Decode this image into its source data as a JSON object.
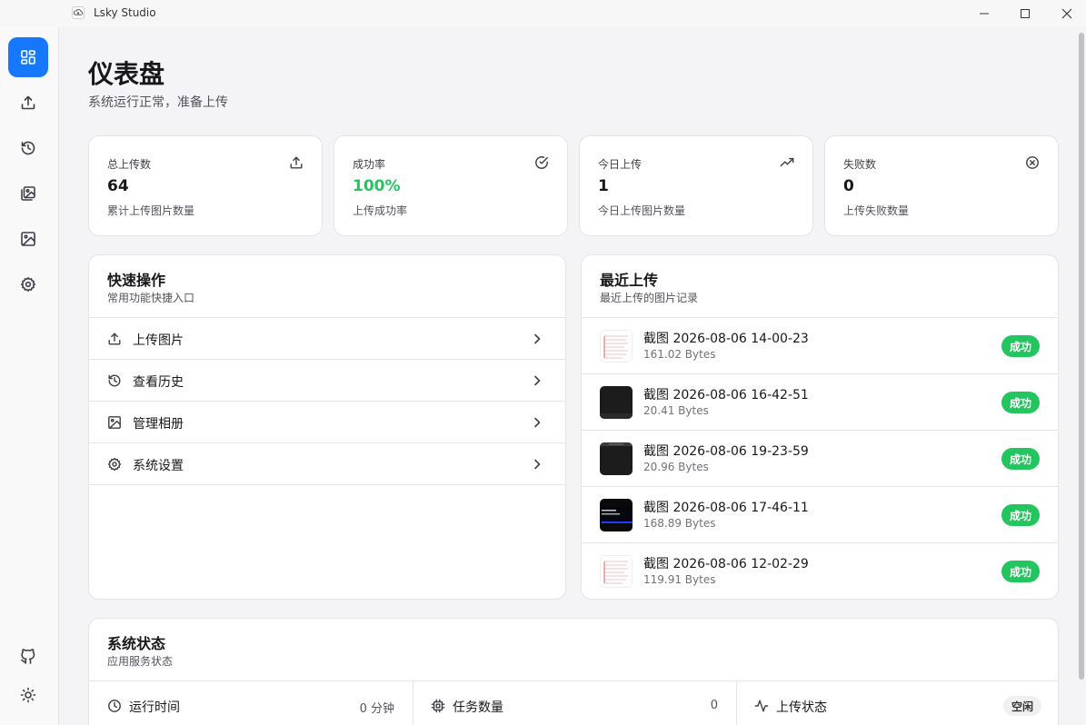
{
  "window": {
    "title": "Lsky Studio"
  },
  "sidebar": {
    "items": [
      {
        "icon": "dashboard-icon",
        "active": true
      },
      {
        "icon": "upload-icon",
        "active": false
      },
      {
        "icon": "history-icon",
        "active": false
      },
      {
        "icon": "gallery-icon",
        "active": false
      },
      {
        "icon": "image-icon",
        "active": false
      },
      {
        "icon": "settings-icon",
        "active": false
      }
    ],
    "bottom": [
      {
        "icon": "github-icon"
      },
      {
        "icon": "theme-sun-icon"
      }
    ]
  },
  "page": {
    "title": "仪表盘",
    "subtitle": "系统运行正常，准备上传"
  },
  "stats": [
    {
      "label": "总上传数",
      "value": "64",
      "desc": "累计上传图片数量",
      "icon": "upload-icon"
    },
    {
      "label": "成功率",
      "value": "100%",
      "desc": "上传成功率",
      "icon": "check-circle-icon",
      "accent": "#22c55e"
    },
    {
      "label": "今日上传",
      "value": "1",
      "desc": "今日上传图片数量",
      "icon": "trending-up-icon"
    },
    {
      "label": "失败数",
      "value": "0",
      "desc": "上传失败数量",
      "icon": "x-circle-icon"
    }
  ],
  "quick_actions": {
    "title": "快速操作",
    "subtitle": "常用功能快捷入口",
    "items": [
      {
        "label": "上传图片",
        "icon": "upload-icon"
      },
      {
        "label": "查看历史",
        "icon": "history-icon"
      },
      {
        "label": "管理相册",
        "icon": "image-icon"
      },
      {
        "label": "系统设置",
        "icon": "settings-icon"
      }
    ]
  },
  "recent_uploads": {
    "title": "最近上传",
    "subtitle": "最近上传的图片记录",
    "items": [
      {
        "name": "截图 2026-08-06 14-00-23",
        "size": "161.02 Bytes",
        "status": "成功",
        "thumb": "light"
      },
      {
        "name": "截图 2026-08-06 16-42-51",
        "size": "20.41 Bytes",
        "status": "成功",
        "thumb": "dark"
      },
      {
        "name": "截图 2026-08-06 19-23-59",
        "size": "20.96 Bytes",
        "status": "成功",
        "thumb": "dark"
      },
      {
        "name": "截图 2026-08-06 17-46-11",
        "size": "168.89 Bytes",
        "status": "成功",
        "thumb": "dark-text"
      },
      {
        "name": "截图 2026-08-06 12-02-29",
        "size": "119.91 Bytes",
        "status": "成功",
        "thumb": "light"
      }
    ]
  },
  "system_status": {
    "title": "系统状态",
    "subtitle": "应用服务状态",
    "items": [
      {
        "label": "运行时间",
        "value": "0 分钟",
        "icon": "clock-icon"
      },
      {
        "label": "任务数量",
        "value": "0",
        "icon": "cpu-icon"
      },
      {
        "label": "上传状态",
        "value": "空闲",
        "icon": "activity-icon"
      }
    ]
  },
  "colors": {
    "accent": "#1677ff",
    "success": "#22c55e"
  }
}
